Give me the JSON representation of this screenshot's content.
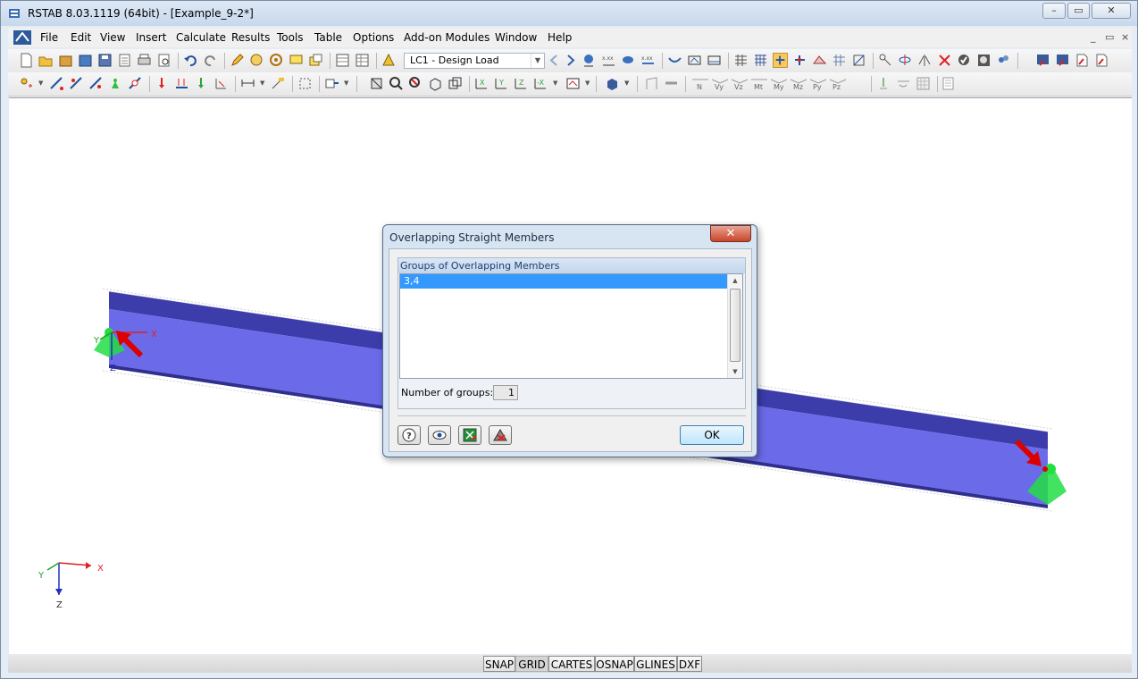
{
  "window": {
    "title": "RSTAB 8.03.1119 (64bit) - [Example_9-2*]",
    "controls": [
      "–",
      "▭",
      "✕"
    ]
  },
  "menubar": {
    "items": [
      "File",
      "Edit",
      "View",
      "Insert",
      "Calculate",
      "Results",
      "Tools",
      "Table",
      "Options",
      "Add-on Modules",
      "Window",
      "Help"
    ],
    "mdi_controls": [
      "_",
      "▭",
      "×"
    ]
  },
  "toolbar": {
    "load_case": "LC1 - Design Load",
    "result_labels": [
      "N",
      "Vy",
      "Vz",
      "Mt",
      "My",
      "Mz",
      "Py",
      "Pz"
    ]
  },
  "model": {
    "axis_labels": {
      "x": "X",
      "y": "Y",
      "z": "Z"
    }
  },
  "dialog": {
    "title": "Overlapping Straight Members",
    "group_header": "Groups of Overlapping Members",
    "items": [
      "3,4"
    ],
    "selected_index": 0,
    "count_label": "Number of groups:",
    "count_value": "1",
    "ok_label": "OK",
    "icon_buttons": [
      "help-icon",
      "view-icon",
      "export-excel-icon",
      "delete-members-icon"
    ]
  },
  "statusbar": {
    "buttons": [
      "SNAP",
      "GRID",
      "CARTES",
      "OSNAP",
      "GLINES",
      "DXF"
    ],
    "active": [
      "GRID"
    ]
  },
  "colors": {
    "beam": "#6b6bea",
    "support": "#22dd44",
    "load_arrow": "#dd0000",
    "selection": "#3399ff"
  }
}
